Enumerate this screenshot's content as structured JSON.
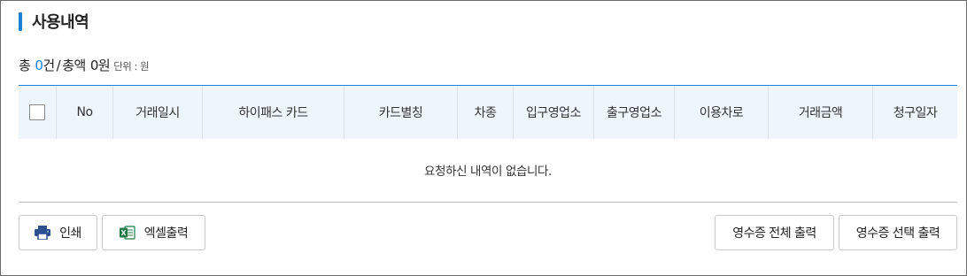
{
  "section": {
    "title": "사용내역",
    "accent_color": "#1c7fd6"
  },
  "summary": {
    "total_label": "총",
    "count": "0",
    "count_suffix": "건",
    "separator": "/",
    "amount_label": "총액",
    "amount": "0",
    "amount_suffix": "원",
    "unit_note": "단위 : 원"
  },
  "table": {
    "columns": [
      "No",
      "거래일시",
      "하이패스 카드",
      "카드별칭",
      "차종",
      "입구영업소",
      "출구영업소",
      "이용차로",
      "거래금액",
      "청구일자"
    ],
    "header_bg": "#eef5fc",
    "empty_message": "요청하신 내역이 없습니다."
  },
  "buttons": {
    "print": {
      "label": "인쇄",
      "icon": "printer-icon"
    },
    "excel": {
      "label": "엑셀출력",
      "icon": "excel-icon"
    },
    "receipt_all": {
      "label": "영수증 전체 출력"
    },
    "receipt_selected": {
      "label": "영수증 선택 출력"
    }
  }
}
